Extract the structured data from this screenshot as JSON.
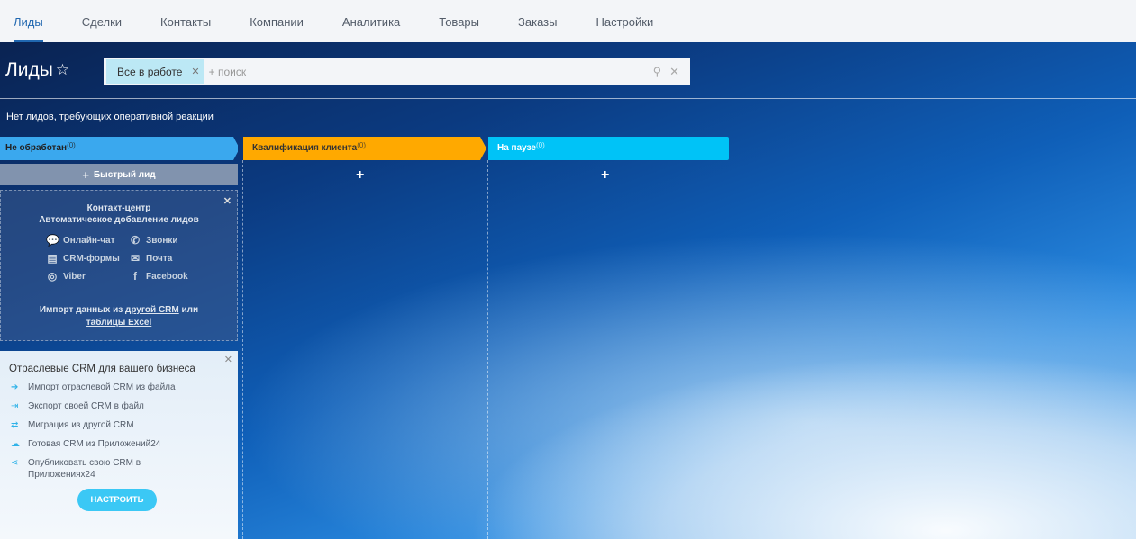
{
  "nav": {
    "tabs": [
      "Лиды",
      "Сделки",
      "Контакты",
      "Компании",
      "Аналитика",
      "Товары",
      "Заказы",
      "Настройки"
    ]
  },
  "page_title": "Лиды",
  "search": {
    "chip": "Все в работе",
    "placeholder": "+ поиск"
  },
  "notice": "Нет лидов, требующих оперативной реакции",
  "columns": [
    {
      "name": "Не обработан",
      "count": "(0)",
      "color": "#3aa8ee"
    },
    {
      "name": "Квалификация клиента",
      "count": "(0)",
      "color": "#ffa900"
    },
    {
      "name": "На паузе",
      "count": "(0)",
      "color": "#00c3f7"
    }
  ],
  "quick_lead": "Быстрый лид",
  "contact_center": {
    "title": "Контакт-центр",
    "subtitle": "Автоматическое добавление лидов",
    "channels": [
      "Онлайн-чат",
      "Звонки",
      "CRM-формы",
      "Почта",
      "Viber",
      "Facebook"
    ],
    "import_prefix": "Импорт данных из",
    "import_link1": "другой CRM",
    "import_mid": "или",
    "import_link2": "таблицы Excel"
  },
  "industry": {
    "title": "Отраслевые CRM для вашего бизнеса",
    "items": [
      "Импорт отраслевой CRM из файла",
      "Экспорт своей CRM в файл",
      "Миграция из другой CRM",
      "Готовая CRM из Приложений24",
      "Опубликовать свою CRM в Приложениях24"
    ],
    "button": "НАСТРОИТЬ"
  }
}
